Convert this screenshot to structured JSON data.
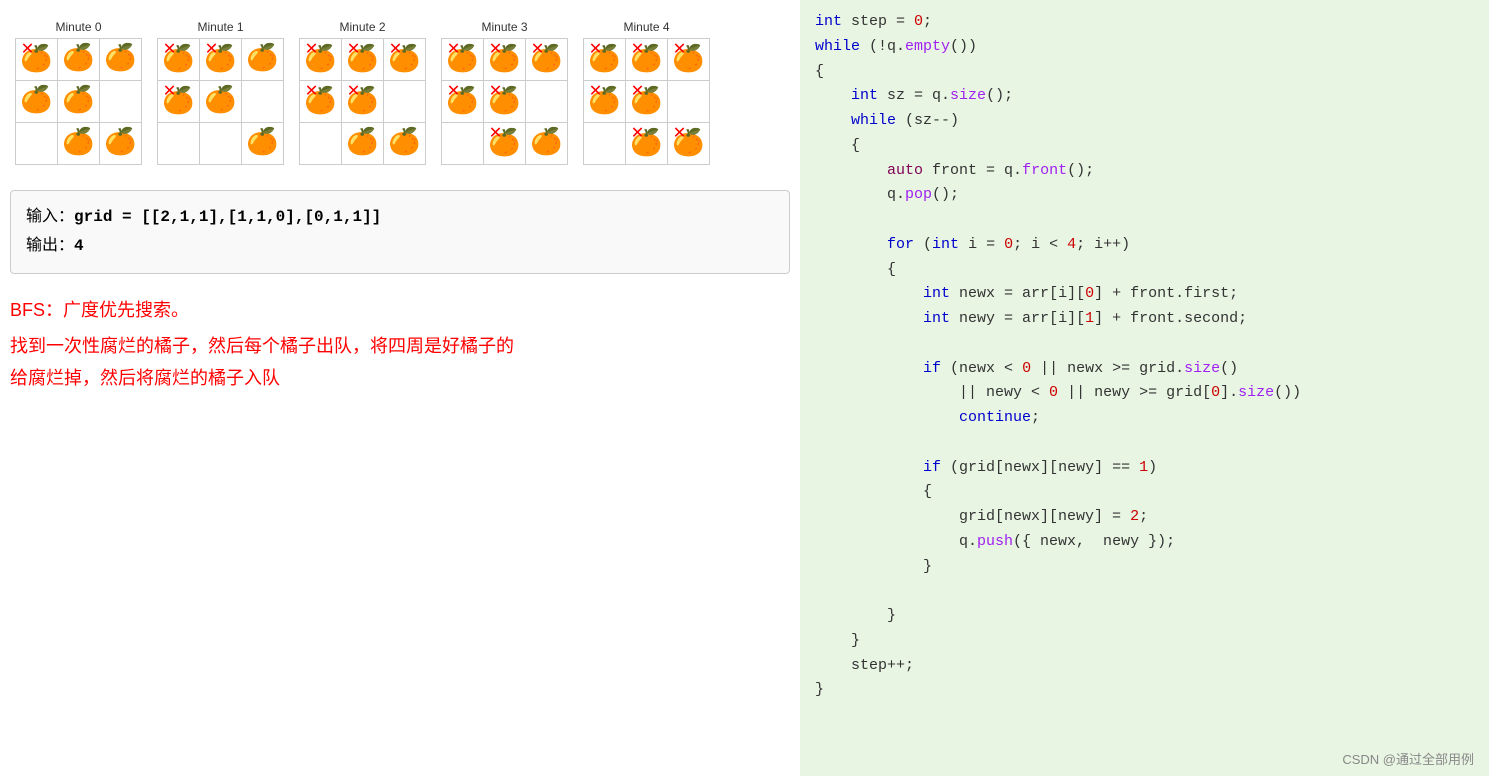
{
  "left": {
    "minutes": [
      {
        "label": "Minute 0",
        "grid": [
          [
            "rotten",
            "fresh",
            "fresh"
          ],
          [
            "fresh",
            "fresh",
            "empty"
          ],
          [
            "empty",
            "fresh",
            "fresh"
          ]
        ]
      },
      {
        "label": "Minute 1",
        "grid": [
          [
            "rotten",
            "rotten",
            "fresh"
          ],
          [
            "rotten",
            "fresh",
            "empty"
          ],
          [
            "empty",
            "empty",
            "fresh"
          ]
        ]
      },
      {
        "label": "Minute 2",
        "grid": [
          [
            "rotten",
            "rotten",
            "rotten"
          ],
          [
            "rotten",
            "rotten",
            "empty"
          ],
          [
            "empty",
            "fresh",
            "fresh"
          ]
        ]
      },
      {
        "label": "Minute 3",
        "grid": [
          [
            "rotten",
            "rotten",
            "rotten"
          ],
          [
            "rotten",
            "rotten",
            "empty"
          ],
          [
            "empty",
            "rotten",
            "fresh"
          ]
        ]
      },
      {
        "label": "Minute 4",
        "grid": [
          [
            "rotten",
            "rotten",
            "rotten"
          ],
          [
            "rotten",
            "rotten",
            "empty"
          ],
          [
            "empty",
            "rotten",
            "rotten"
          ]
        ]
      }
    ],
    "example": {
      "input_label": "输入：",
      "input_value": "grid = [[2,1,1],[1,1,0],[0,1,1]]",
      "output_label": "输出：",
      "output_value": "4"
    },
    "bfs_title": "BFS：广度优先搜索。",
    "bfs_desc": "找到一次性腐烂的橘子，然后每个橘子出队，将四周是好橘子的\n给腐烂掉，然后将腐烂的橘子入队"
  },
  "right": {
    "watermark": "CSDN @通过全部用例",
    "code_lines": [
      {
        "parts": [
          {
            "t": "kw",
            "v": "int"
          },
          {
            "t": "plain",
            "v": " step = "
          },
          {
            "t": "num",
            "v": "0"
          },
          {
            "t": "plain",
            "v": ";"
          }
        ]
      },
      {
        "parts": [
          {
            "t": "kw",
            "v": "while"
          },
          {
            "t": "plain",
            "v": " (!q."
          },
          {
            "t": "fn",
            "v": "empty"
          },
          {
            "t": "plain",
            "v": "())"
          }
        ]
      },
      {
        "parts": [
          {
            "t": "plain",
            "v": "{"
          }
        ]
      },
      {
        "parts": [
          {
            "t": "plain",
            "v": "    "
          },
          {
            "t": "kw",
            "v": "int"
          },
          {
            "t": "plain",
            "v": " sz = q."
          },
          {
            "t": "fn",
            "v": "size"
          },
          {
            "t": "plain",
            "v": "();"
          }
        ]
      },
      {
        "parts": [
          {
            "t": "plain",
            "v": "    "
          },
          {
            "t": "kw",
            "v": "while"
          },
          {
            "t": "plain",
            "v": " (sz--)"
          }
        ]
      },
      {
        "parts": [
          {
            "t": "plain",
            "v": "    {"
          }
        ]
      },
      {
        "parts": [
          {
            "t": "plain",
            "v": "        "
          },
          {
            "t": "kw2",
            "v": "auto"
          },
          {
            "t": "plain",
            "v": " front = q."
          },
          {
            "t": "fn",
            "v": "front"
          },
          {
            "t": "plain",
            "v": "();"
          }
        ]
      },
      {
        "parts": [
          {
            "t": "plain",
            "v": "        q."
          },
          {
            "t": "fn",
            "v": "pop"
          },
          {
            "t": "plain",
            "v": "();"
          }
        ]
      },
      {
        "parts": []
      },
      {
        "parts": [
          {
            "t": "plain",
            "v": "        "
          },
          {
            "t": "kw",
            "v": "for"
          },
          {
            "t": "plain",
            "v": " ("
          },
          {
            "t": "kw",
            "v": "int"
          },
          {
            "t": "plain",
            "v": " i = "
          },
          {
            "t": "num",
            "v": "0"
          },
          {
            "t": "plain",
            "v": "; i < "
          },
          {
            "t": "num",
            "v": "4"
          },
          {
            "t": "plain",
            "v": "; i++)"
          }
        ]
      },
      {
        "parts": [
          {
            "t": "plain",
            "v": "        {"
          }
        ]
      },
      {
        "parts": [
          {
            "t": "plain",
            "v": "            "
          },
          {
            "t": "kw",
            "v": "int"
          },
          {
            "t": "plain",
            "v": " newx = arr[i]["
          },
          {
            "t": "num",
            "v": "0"
          },
          {
            "t": "plain",
            "v": "] + front.first;"
          }
        ]
      },
      {
        "parts": [
          {
            "t": "plain",
            "v": "            "
          },
          {
            "t": "kw",
            "v": "int"
          },
          {
            "t": "plain",
            "v": " newy = arr[i]["
          },
          {
            "t": "num",
            "v": "1"
          },
          {
            "t": "plain",
            "v": "] + front.second;"
          }
        ]
      },
      {
        "parts": []
      },
      {
        "parts": [
          {
            "t": "plain",
            "v": "            "
          },
          {
            "t": "kw",
            "v": "if"
          },
          {
            "t": "plain",
            "v": " (newx < "
          },
          {
            "t": "num",
            "v": "0"
          },
          {
            "t": "plain",
            "v": " || newx >= grid."
          },
          {
            "t": "fn",
            "v": "size"
          },
          {
            "t": "plain",
            "v": "()"
          }
        ]
      },
      {
        "parts": [
          {
            "t": "plain",
            "v": "                || newy < "
          },
          {
            "t": "num",
            "v": "0"
          },
          {
            "t": "plain",
            "v": " || newy >= grid["
          },
          {
            "t": "num",
            "v": "0"
          },
          {
            "t": "plain",
            "v": "]."
          },
          {
            "t": "fn",
            "v": "size"
          },
          {
            "t": "plain",
            "v": "())"
          }
        ]
      },
      {
        "parts": [
          {
            "t": "plain",
            "v": "                "
          },
          {
            "t": "kw",
            "v": "continue"
          },
          {
            "t": "plain",
            "v": ";"
          }
        ]
      },
      {
        "parts": []
      },
      {
        "parts": [
          {
            "t": "plain",
            "v": "            "
          },
          {
            "t": "kw",
            "v": "if"
          },
          {
            "t": "plain",
            "v": " (grid[newx][newy] == "
          },
          {
            "t": "num",
            "v": "1"
          },
          {
            "t": "plain",
            "v": ")"
          }
        ]
      },
      {
        "parts": [
          {
            "t": "plain",
            "v": "            {"
          }
        ]
      },
      {
        "parts": [
          {
            "t": "plain",
            "v": "                grid[newx][newy] = "
          },
          {
            "t": "num",
            "v": "2"
          },
          {
            "t": "plain",
            "v": ";"
          }
        ]
      },
      {
        "parts": [
          {
            "t": "plain",
            "v": "                q."
          },
          {
            "t": "fn",
            "v": "push"
          },
          {
            "t": "plain",
            "v": "({ newx,  newy });"
          }
        ]
      },
      {
        "parts": [
          {
            "t": "plain",
            "v": "            }"
          }
        ]
      },
      {
        "parts": []
      },
      {
        "parts": [
          {
            "t": "plain",
            "v": "        }"
          }
        ]
      },
      {
        "parts": [
          {
            "t": "plain",
            "v": "    }"
          }
        ]
      },
      {
        "parts": [
          {
            "t": "plain",
            "v": "    step++;"
          }
        ]
      },
      {
        "parts": [
          {
            "t": "plain",
            "v": "}"
          }
        ]
      }
    ]
  }
}
